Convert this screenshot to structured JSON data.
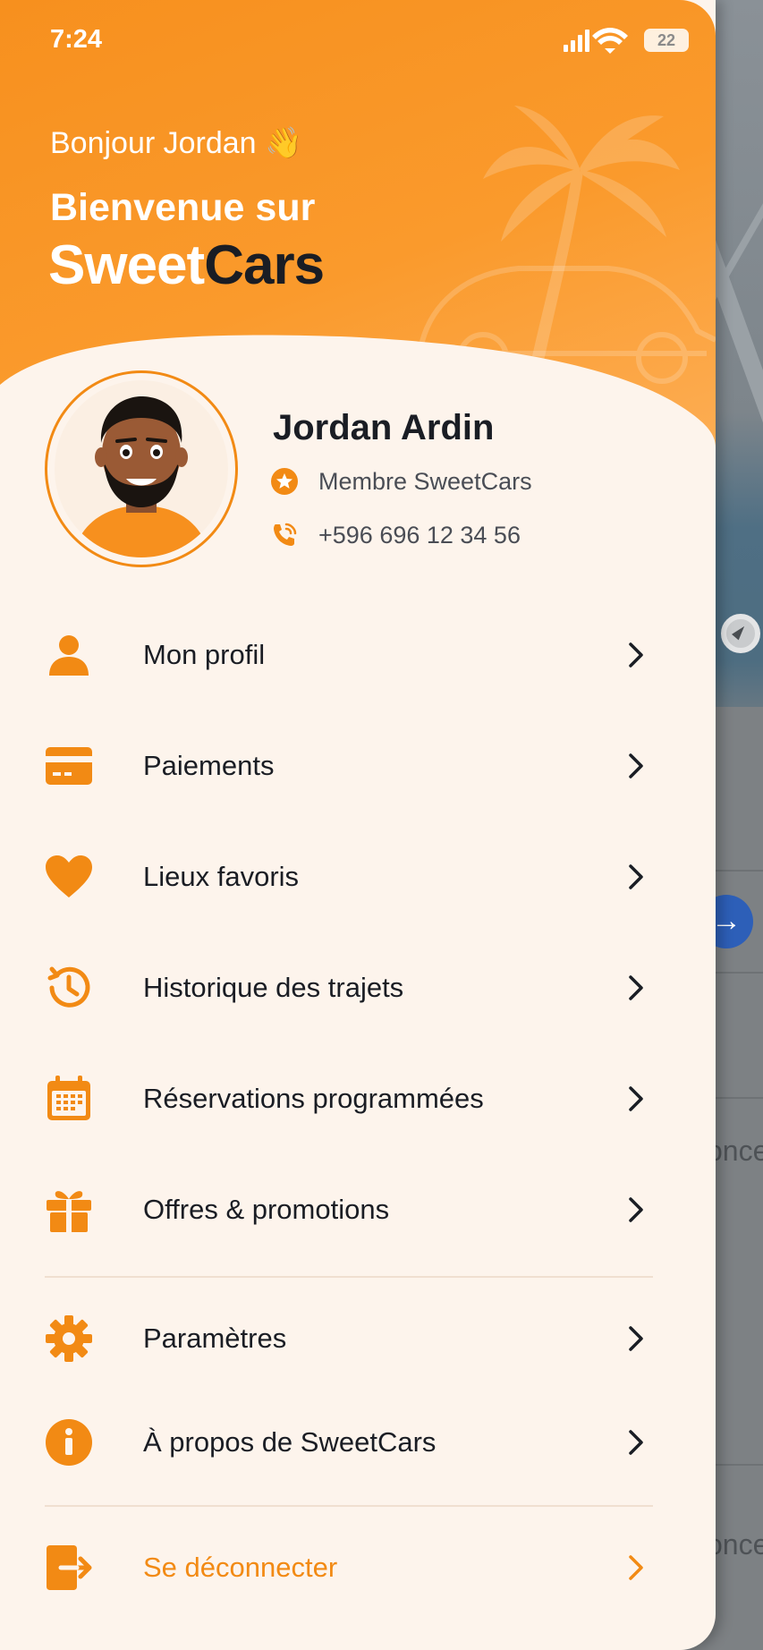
{
  "status_bar": {
    "time": "7:24",
    "battery": "22"
  },
  "header": {
    "greeting": "Bonjour Jordan 👋",
    "welcome": "Bienvenue sur",
    "brand_part1": "Sweet",
    "brand_part2": "Cars"
  },
  "profile": {
    "name": "Jordan Ardin",
    "membership": "Membre SweetCars",
    "phone": "+596 696 12 34 56"
  },
  "menu": {
    "items": [
      {
        "label": "Mon profil",
        "icon": "person-icon"
      },
      {
        "label": "Paiements",
        "icon": "credit-card-icon"
      },
      {
        "label": "Lieux favoris",
        "icon": "heart-icon"
      },
      {
        "label": "Historique des trajets",
        "icon": "history-clock-icon"
      },
      {
        "label": "Réservations programmées",
        "icon": "calendar-icon"
      },
      {
        "label": "Offres & promotions",
        "icon": "gift-icon"
      }
    ],
    "secondary": [
      {
        "label": "Paramètres",
        "icon": "gear-icon"
      },
      {
        "label": "À propos de SweetCars",
        "icon": "info-icon"
      }
    ],
    "logout": {
      "label": "Se déconnecter",
      "icon": "logout-icon"
    }
  },
  "colors": {
    "accent": "#f28a14",
    "text": "#1a1d24",
    "background": "#fdf4ec"
  }
}
